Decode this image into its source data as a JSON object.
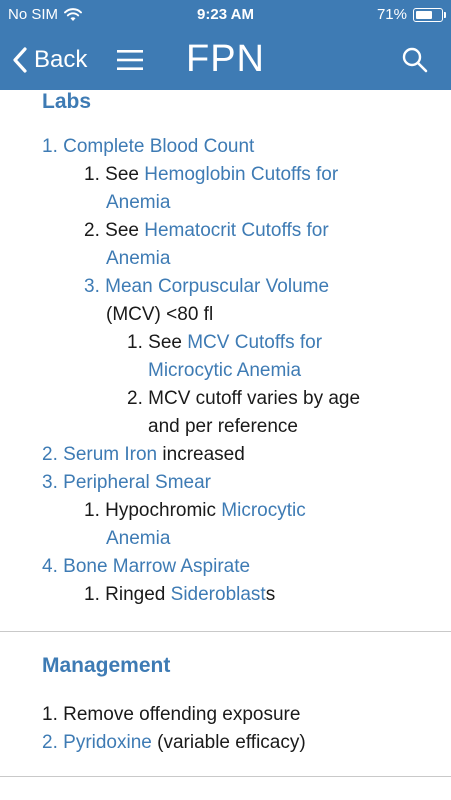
{
  "status_bar": {
    "carrier": "No SIM",
    "time": "9:23 AM",
    "battery_percent": "71%",
    "battery_level": 0.71,
    "wifi_icon": "wifi-icon",
    "battery_icon": "battery-icon"
  },
  "nav": {
    "back_label": "Back",
    "title": "FPN",
    "menu_icon": "hamburger-menu-icon",
    "search_icon": "search-icon"
  },
  "colors": {
    "accent": "#3e7bb4",
    "text": "#1a1a1a",
    "divider": "#c9c9c9"
  },
  "labs": {
    "heading": "Labs",
    "items": [
      {
        "num": "1.",
        "label": "Complete Blood Count"
      },
      {
        "num": "1.",
        "prefix": "See ",
        "link1": "Hemoglobin Cutoffs for",
        "link2": "Anemia"
      },
      {
        "num": "2.",
        "prefix": "See ",
        "link1": "Hematocrit Cutoffs for",
        "link2": "Anemia"
      },
      {
        "num": "3.",
        "label": "Mean Corpuscular Volume",
        "cont": "(MCV) <80 fl"
      },
      {
        "num": "1.",
        "prefix": "See ",
        "link1": "MCV Cutoffs for",
        "link2": "Microcytic Anemia"
      },
      {
        "num": "2.",
        "text1": "MCV cutoff varies by age",
        "text2": "and per reference"
      },
      {
        "num": "2.",
        "label": "Serum Iron",
        "suffix": " increased"
      },
      {
        "num": "3.",
        "label": "Peripheral Smear"
      },
      {
        "num": "1.",
        "prefix": "Hypochromic ",
        "link1": "Microcytic",
        "link2": "Anemia"
      },
      {
        "num": "4.",
        "label": "Bone Marrow Aspirate"
      },
      {
        "num": "1.",
        "prefix": "Ringed ",
        "link1": "Sideroblast",
        "suffix": "s"
      }
    ]
  },
  "management": {
    "heading": "Management",
    "items": [
      {
        "num": "1.",
        "text": "Remove offending exposure"
      },
      {
        "num": "2.",
        "label": "Pyridoxine",
        "suffix": " (variable efficacy)"
      }
    ]
  }
}
